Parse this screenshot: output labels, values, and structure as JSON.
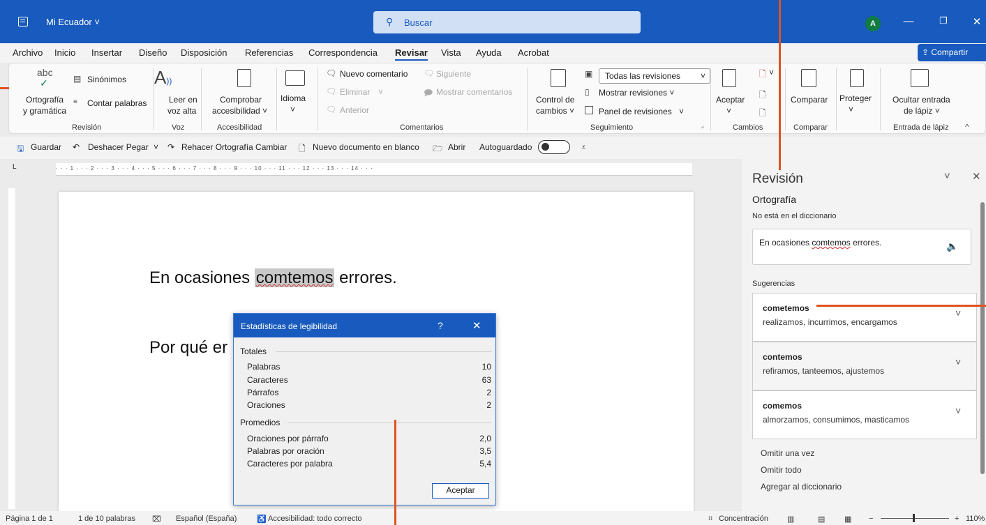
{
  "titlebar": {
    "doc_title": "Mi Ecuador ˅",
    "search_placeholder": "Buscar",
    "avatar": "A"
  },
  "menu": {
    "tabs": [
      "Archivo",
      "Inicio",
      "Insertar",
      "Diseño",
      "Disposición",
      "Referencias",
      "Correspondencia",
      "Revisar",
      "Vista",
      "Ayuda",
      "Acrobat"
    ],
    "share": "Compartir"
  },
  "ribbon": {
    "abc": "abc",
    "ortografia": "Ortografía",
    "gramatica": "y gramática",
    "sinonimos": "Sinónimos",
    "contar": "Contar palabras",
    "grp_revision": "Revisión",
    "leer1": "Leer en",
    "leer2": "voz alta",
    "grp_voz": "Voz",
    "comprobar1": "Comprobar",
    "comprobar2": "accesibilidad ˅",
    "grp_accesibilidad": "Accesibilidad",
    "idioma": "Idioma",
    "idioma_chev": "˅",
    "nuevo_comentario": "Nuevo comentario",
    "eliminar": "Eliminar",
    "anterior": "Anterior",
    "siguiente": "Siguiente",
    "mostrar_comentarios": "Mostrar comentarios",
    "grp_comentarios": "Comentarios",
    "control1": "Control de",
    "control2": "cambios ˅",
    "todas_revisiones": "Todas las revisiones",
    "mostrar_revisiones": "Mostrar revisiones ˅",
    "panel_revisiones": "Panel de revisiones",
    "grp_seguimiento": "Seguimiento",
    "aceptar": "Aceptar",
    "aceptar_chev": "˅",
    "grp_cambios": "Cambios",
    "comparar": "Comparar",
    "grp_comparar": "Comparar",
    "proteger": "Proteger",
    "proteger_chev": "˅",
    "ocultar1": "Ocultar entrada",
    "ocultar2": "de lápiz ˅",
    "grp_lapiz": "Entrada de lápiz"
  },
  "qat": {
    "guardar": "Guardar",
    "deshacer": "Deshacer Pegar",
    "rehacer": "Rehacer Ortografía Cambiar",
    "nuevo": "Nuevo documento en blanco",
    "abrir": "Abrir",
    "autoguardado": "Autoguardado"
  },
  "ruler": {
    "ticks": "· · · 1 · · · 2 · · · 3 · · · 4 · · · 5 · · · 6 · · · 7 · · · 8 · · · 9 · · · 10 · · · 11 · · · 12 · · · 13 · · · 14 · · ·"
  },
  "document": {
    "line1_before": "En ocasiones ",
    "line1_word": "comtemos",
    "line1_after": " errores.",
    "line2": "Por qué er"
  },
  "dialog": {
    "title": "Estadísticas de legibilidad",
    "help": "?",
    "close": "✕",
    "totales": "Totales",
    "totales_rows": [
      {
        "label": "Palabras",
        "value": "10"
      },
      {
        "label": "Caracteres",
        "value": "63"
      },
      {
        "label": "Párrafos",
        "value": "2"
      },
      {
        "label": "Oraciones",
        "value": "2"
      }
    ],
    "promedios": "Promedios",
    "promedios_rows": [
      {
        "label": "Oraciones por párrafo",
        "value": "2,0"
      },
      {
        "label": "Palabras por oración",
        "value": "3,5"
      },
      {
        "label": "Caracteres por palabra",
        "value": "5,4"
      }
    ],
    "ok": "Aceptar"
  },
  "pane": {
    "title": "Revisión",
    "section": "Ortografía",
    "not_in_dict": "No está en el diccionario",
    "context_before": "En ocasiones ",
    "context_word": "comtemos",
    "context_after": " errores.",
    "suggestions_label": "Sugerencias",
    "suggestions": [
      {
        "word": "cometemos",
        "synonyms": "realizamos, incurrimos, encargamos"
      },
      {
        "word": "contemos",
        "synonyms": "refiramos, tanteemos, ajustemos"
      },
      {
        "word": "comemos",
        "synonyms": "almorzamos, consumimos, masticamos"
      }
    ],
    "omitir_vez": "Omitir una vez",
    "omitir_todo": "Omitir todo",
    "agregar": "Agregar al diccionario"
  },
  "status": {
    "pagina": "Página 1 de 1",
    "palabras": "1 de 10 palabras",
    "idioma": "Español (España)",
    "accesibilidad": "Accesibilidad: todo correcto",
    "concentracion": "Concentración",
    "zoom": "110%"
  },
  "colors": {
    "brand": "#185abd",
    "callout": "#e0531f",
    "misspelling": "#d13438"
  }
}
